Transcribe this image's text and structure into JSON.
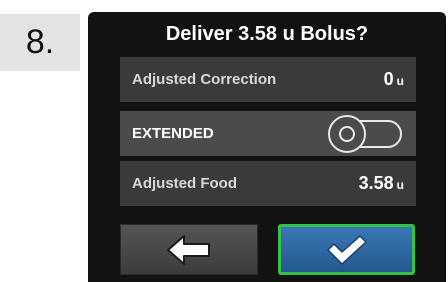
{
  "step_number": "8.",
  "dialog": {
    "title": "Deliver 3.58 u Bolus?",
    "adjusted_correction": {
      "label": "Adjusted Correction",
      "value": "0",
      "unit": "u"
    },
    "extended": {
      "label": "EXTENDED",
      "toggle_on": false,
      "toggle_icon": "toggle-off-icon"
    },
    "adjusted_food": {
      "label": "Adjusted Food",
      "value": "3.58",
      "unit": "u"
    },
    "buttons": {
      "back_icon": "back-arrow-icon",
      "confirm_icon": "checkmark-icon"
    }
  },
  "colors": {
    "screen_bg": "#121212",
    "row_bg": "#3a3a3a",
    "row_active_bg": "#4b4b4b",
    "confirm_bg": "#2f6aa3",
    "confirm_border": "#35c24a"
  }
}
